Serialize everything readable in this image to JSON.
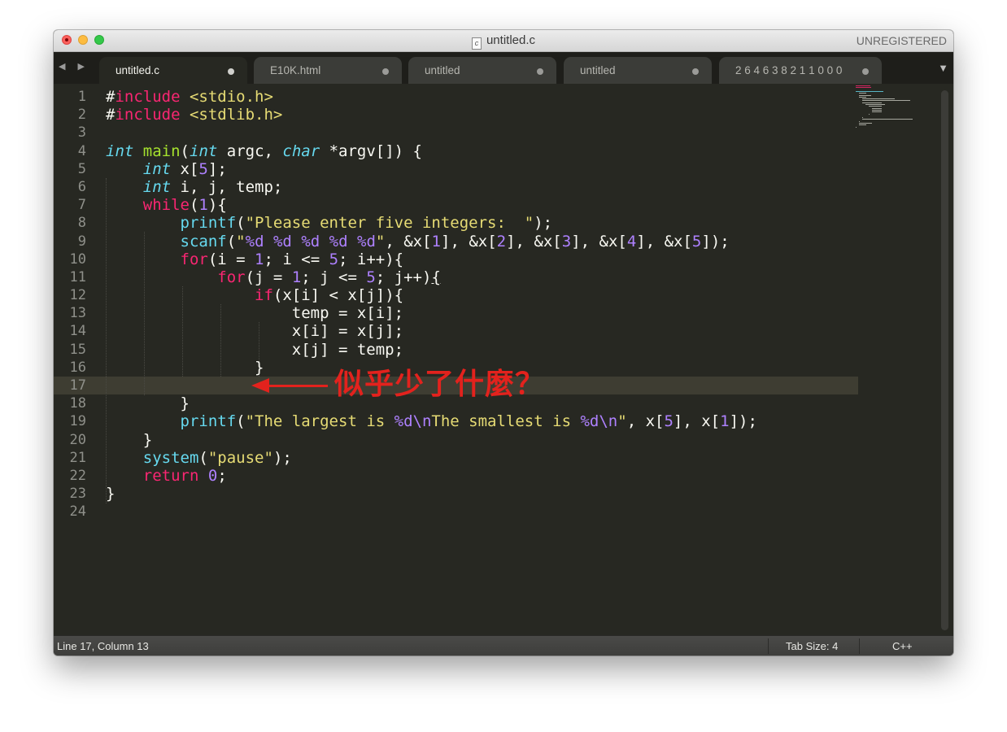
{
  "window": {
    "title": "untitled.c",
    "file_icon": "c",
    "unregistered": "UNREGISTERED"
  },
  "nav": {
    "arrows": "◀ ▶"
  },
  "tabs": [
    {
      "label": "untitled.c",
      "active": true
    },
    {
      "label": "E10K.html",
      "active": false
    },
    {
      "label": "untitled",
      "active": false
    },
    {
      "label": "untitled",
      "active": false
    },
    {
      "label": "2 6 4 6 3 8 2 1 1 0 0 0",
      "active": false
    }
  ],
  "tab_overflow": "▼",
  "line_numbers": [
    "1",
    "2",
    "3",
    "4",
    "5",
    "6",
    "7",
    "8",
    "9",
    "10",
    "11",
    "12",
    "13",
    "14",
    "15",
    "16",
    "17",
    "18",
    "19",
    "20",
    "21",
    "22",
    "23",
    "24"
  ],
  "code_lines": [
    "#include <stdio.h>",
    "#include <stdlib.h>",
    "",
    "int main(int argc, char *argv[]) {",
    "    int x[5];",
    "    int i, j, temp;",
    "    while(1){",
    "        printf(\"Please enter five integers:  \");",
    "        scanf(\"%d %d %d %d %d\", &x[1], &x[2], &x[3], &x[4], &x[5]);",
    "        for(i = 1; i <= 5; i++){",
    "            for(j = 1; j <= 5; j++){",
    "                if(x[i] < x[j]){",
    "                    temp = x[i];",
    "                    x[i] = x[j];",
    "                    x[j] = temp;",
    "                }",
    "",
    "        }",
    "        printf(\"The largest is %d\\nThe smallest is %d\\n\", x[5], x[1]);",
    "    }",
    "    system(\"pause\");",
    "    return 0;",
    "}",
    ""
  ],
  "annotation": {
    "text": "似乎少了什麼？",
    "color": "#e3221d"
  },
  "status": {
    "position": "Line 17, Column 13",
    "tab_size": "Tab Size: 4",
    "syntax": "C++"
  },
  "colors": {
    "keyword": "#f92672",
    "string": "#e6db74",
    "number": "#ae81ff",
    "type": "#66d9ef",
    "function": "#a6e22e",
    "background": "#272822"
  }
}
